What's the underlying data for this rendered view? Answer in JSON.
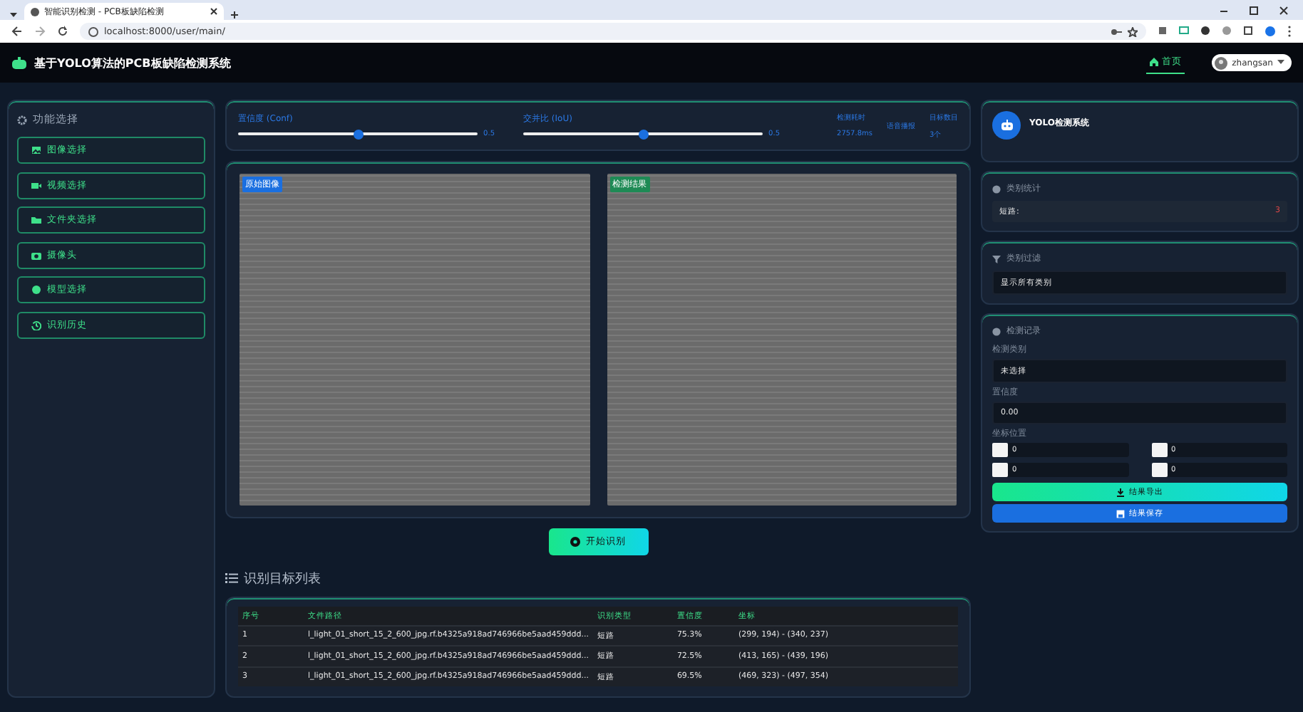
{
  "browser": {
    "tab_title": "智能识别检测 - PCB板缺陷检测",
    "address": "localhost:8000/user/main/"
  },
  "header": {
    "title": "基于YOLO算法的PCB板缺陷检测系统",
    "nav": [
      {
        "label": "首页",
        "selected": true
      }
    ],
    "user": "zhangsan"
  },
  "sidebar": {
    "title": "功能选择",
    "items": [
      {
        "label": "图像选择"
      },
      {
        "label": "视频选择"
      },
      {
        "label": "文件夹选择"
      },
      {
        "label": "摄像头"
      },
      {
        "label": "模型选择"
      },
      {
        "label": "识别历史"
      }
    ]
  },
  "controls": {
    "sliders": [
      {
        "label": "置信度 (Conf)",
        "level": 0.5,
        "reading": "0.5"
      },
      {
        "label": "交并比 (IoU)",
        "level": 0.5,
        "reading": "0.5"
      }
    ],
    "metrics": [
      {
        "kind": "stat",
        "label": "检测耗时",
        "value": "2757.8ms"
      },
      {
        "kind": "link",
        "label": "语音播报"
      },
      {
        "kind": "stat",
        "label": "目标数目",
        "value": "3个"
      }
    ]
  },
  "images": [
    {
      "badge": "原始图像",
      "color": "#1a6fe0"
    },
    {
      "badge": "检测结果",
      "color": "#1e8a55"
    }
  ],
  "start_button": "开始识别",
  "table": {
    "title": "识别目标列表",
    "columns": [
      "序号",
      "文件路径",
      "识别类型",
      "置信度",
      "坐标"
    ],
    "rows": [
      [
        "1",
        "l_light_01_short_15_2_600_jpg.rf.b4325a918ad746966be5aad459ddd...",
        "短路",
        "75.3%",
        "(299, 194) - (340, 237)"
      ],
      [
        "2",
        "l_light_01_short_15_2_600_jpg.rf.b4325a918ad746966be5aad459ddd...",
        "短路",
        "72.5%",
        "(413, 165) - (439, 196)"
      ],
      [
        "3",
        "l_light_01_short_15_2_600_jpg.rf.b4325a918ad746966be5aad459ddd...",
        "短路",
        "69.5%",
        "(469, 323) - (497, 354)"
      ]
    ]
  },
  "right": {
    "info": {
      "title": "YOLO检测系统"
    },
    "stats": {
      "title": "类别统计",
      "items": [
        {
          "label": "短路:",
          "count": "3"
        }
      ]
    },
    "filter": {
      "title": "类别过滤",
      "value": "显示所有类别"
    },
    "record": {
      "title": "检测记录",
      "fields": [
        {
          "label": "检测类别",
          "value": "未选择"
        },
        {
          "label": "置信度",
          "value": "0.00"
        }
      ],
      "position_label": "坐标位置",
      "positions": [
        "0",
        "0",
        "0",
        "0"
      ]
    },
    "buttons": [
      {
        "kind": "export",
        "label": "结果导出"
      },
      {
        "kind": "save",
        "label": "结果保存"
      }
    ]
  }
}
